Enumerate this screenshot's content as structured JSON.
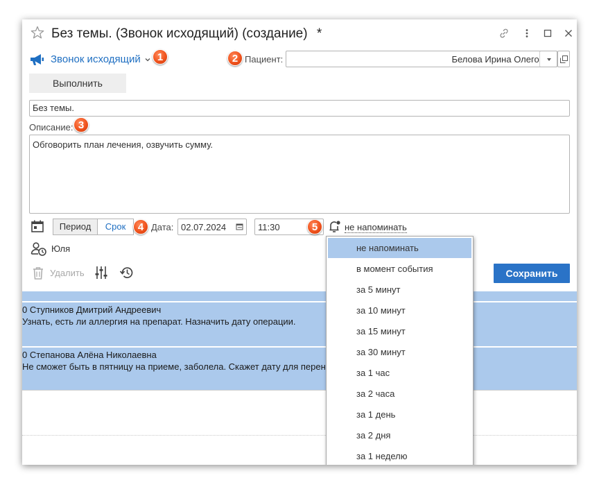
{
  "window": {
    "title": "Без темы. (Звонок исходящий) (создание)",
    "modified_mark": "*"
  },
  "header": {
    "type_label": "Звонок исходящий",
    "patient_label": "Пациент:",
    "patient_value": "Белова Ирина Олеговна"
  },
  "toolbar": {
    "execute_label": "Выполнить"
  },
  "subject": {
    "value": "Без темы."
  },
  "description": {
    "label": "Описание:",
    "value": "Обговорить план лечения, озвучить сумму."
  },
  "schedule": {
    "period_label": "Период",
    "deadline_label": "Срок",
    "date_label": "Дата:",
    "date_value": "02.07.2024",
    "time_value": "11:30",
    "reminder_value": "не напоминать"
  },
  "responsible": {
    "name": "Юля"
  },
  "actions": {
    "delete_label": "Удалить",
    "save_label": "Сохранить"
  },
  "callouts": [
    "1",
    "2",
    "3",
    "4",
    "5"
  ],
  "list": [
    {
      "title": "0 Ступников Дмитрий Андреевич",
      "text": "Узнать, есть ли аллергия на препарат. Назначить дату операции."
    },
    {
      "title": "0 Степанова Алёна Николаевна",
      "text": "Не сможет быть в пятницу на приеме, заболела. Скажет дату для перенос"
    }
  ],
  "reminder_options": [
    "не напоминать",
    "в момент события",
    "за 5 минут",
    "за 10 минут",
    "за 15 минут",
    "за 30 минут",
    "за 1 час",
    "за 2 часа",
    "за 1 день",
    "за 2 дня",
    "за 1 неделю"
  ],
  "colors": {
    "accent": "#1f6fc2",
    "save_button": "#2a73c7",
    "selection": "#abc9ec",
    "badge": "#f0531d"
  }
}
